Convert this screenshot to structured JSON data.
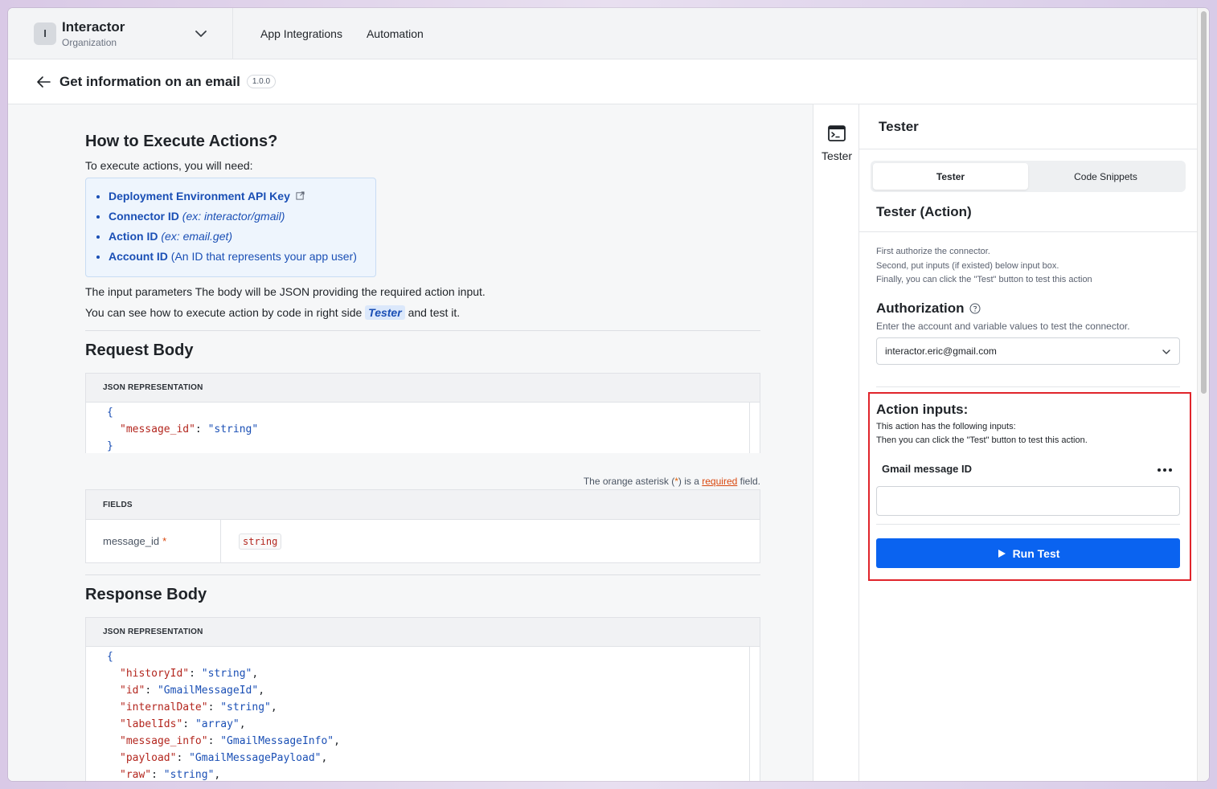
{
  "org": {
    "initial": "I",
    "name": "Interactor",
    "subtitle": "Organization"
  },
  "nav": {
    "links": [
      "App Integrations",
      "Automation"
    ]
  },
  "page": {
    "title": "Get information on an email",
    "version": "1.0.0"
  },
  "docs": {
    "heading": "How to Execute Actions?",
    "intro": "To execute actions, you will need:",
    "requirements": [
      {
        "name": "Deployment Environment API Key",
        "detail": ""
      },
      {
        "name": "Connector ID",
        "detail": "(ex: interactor/gmail)"
      },
      {
        "name": "Action ID",
        "detail": "(ex: email.get)"
      },
      {
        "name": "Account ID",
        "detail": "(An ID that represents your app user)"
      }
    ],
    "input_params": "The input parameters The body will be JSON providing the required action input.",
    "see_how_prefix": "You can see how to execute action by code in right side",
    "see_how_chip": "Tester",
    "see_how_suffix": "and test it.",
    "request_heading": "Request Body",
    "json_rep_label": "JSON REPRESENTATION",
    "request_json": {
      "open": "{",
      "key": "\"message_id\"",
      "value": "\"string\"",
      "close": "}"
    },
    "note_prefix": "The orange asterisk (",
    "note_asterisk": "*",
    "note_middle": ") is a",
    "note_link": "required",
    "note_suffix": "field.",
    "fields_label": "FIELDS",
    "field_row": {
      "name": "message_id",
      "asterisk": "*",
      "type": "string"
    },
    "response_heading": "Response Body",
    "response_json": [
      {
        "key": "\"historyId\"",
        "value": "\"string\""
      },
      {
        "key": "\"id\"",
        "value": "\"GmailMessageId\""
      },
      {
        "key": "\"internalDate\"",
        "value": "\"string\""
      },
      {
        "key": "\"labelIds\"",
        "value": "\"array\""
      },
      {
        "key": "\"message_info\"",
        "value": "\"GmailMessageInfo\""
      },
      {
        "key": "\"payload\"",
        "value": "\"GmailMessagePayload\""
      },
      {
        "key": "\"raw\"",
        "value": "\"string\""
      }
    ]
  },
  "rail": {
    "label": "Tester",
    "icon": "terminal-window-icon"
  },
  "tester": {
    "title": "Tester",
    "tabs": [
      "Tester",
      "Code Snippets"
    ],
    "active_tab": "Tester",
    "section_title": "Tester (Action)",
    "instructions": [
      "First authorize the connector.",
      "Second, put inputs (if existed) below input box.",
      "Finally, you can click the \"Test\" button to test this action"
    ],
    "auth_title": "Authorization",
    "auth_desc": "Enter the account and variable values to test the connector.",
    "account_selected": "interactor.eric@gmail.com",
    "action_inputs_title": "Action  inputs:",
    "action_inputs_desc": [
      "This action has the following inputs:",
      "Then you can click the \"Test\" button to test this action."
    ],
    "field_label": "Gmail message ID",
    "field_value": "",
    "run_label": "Run Test"
  },
  "colors": {
    "primary": "#0a63f0",
    "link": "#1a4fb5",
    "highlight_border": "#e0242b",
    "required": "#d9480f"
  }
}
